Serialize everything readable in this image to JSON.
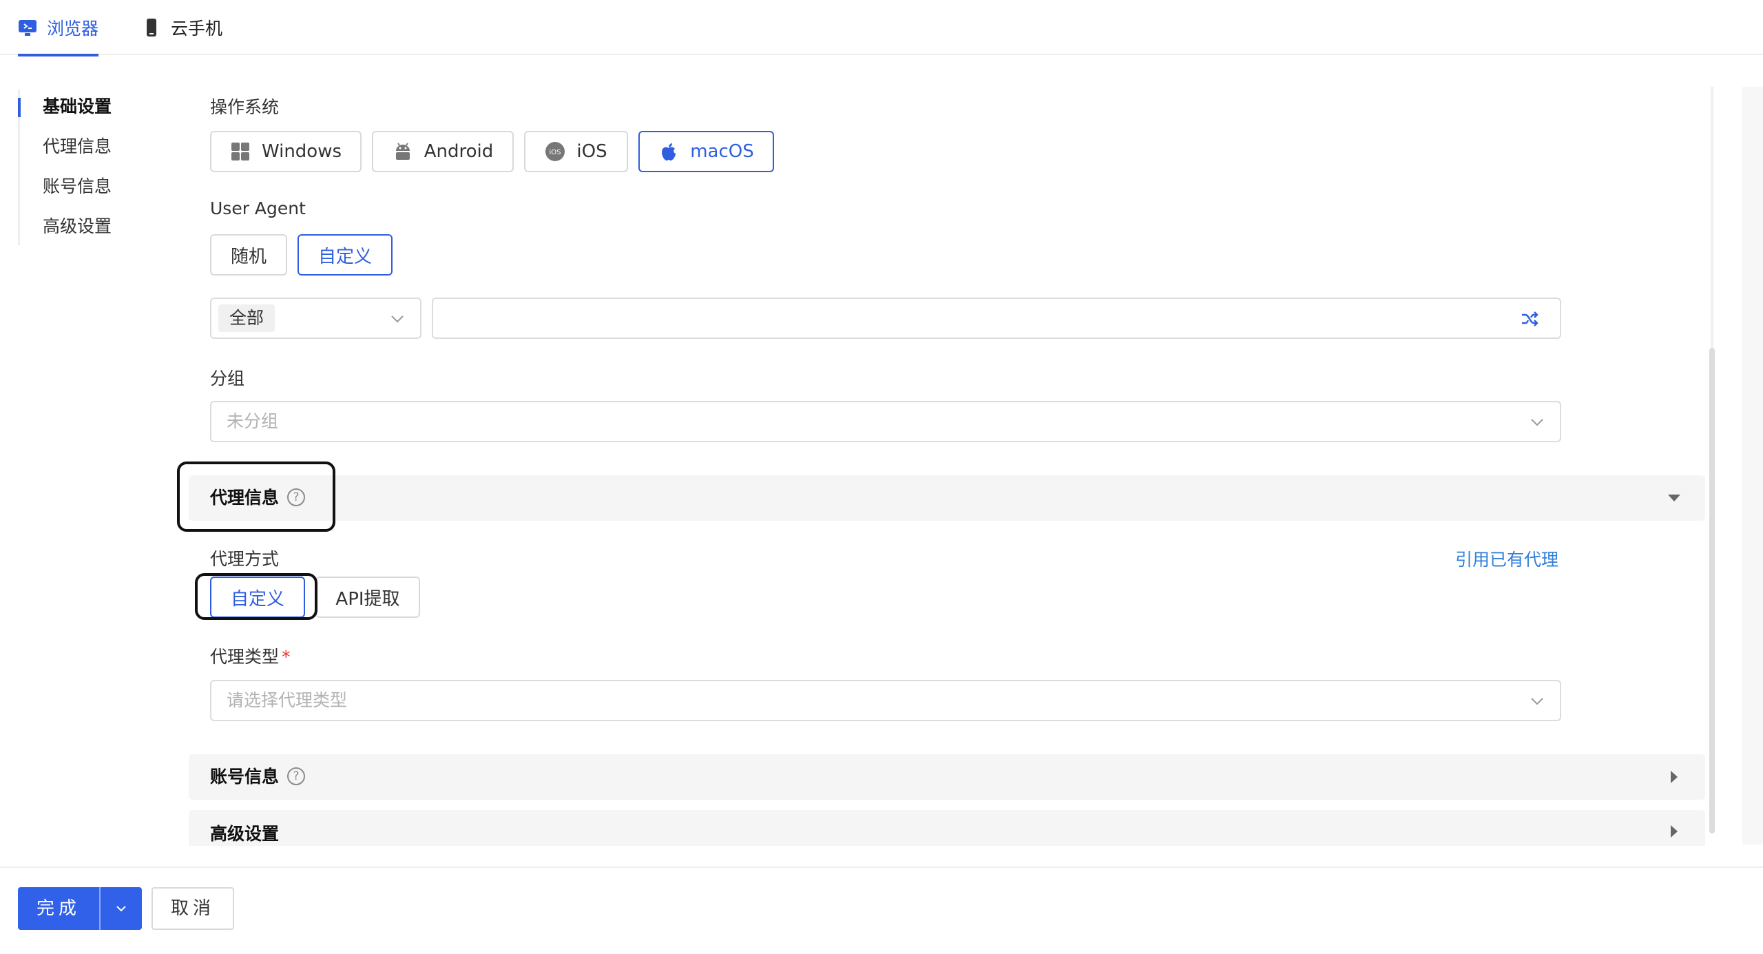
{
  "top_tabs": [
    {
      "label": "浏览器",
      "icon": "browser-icon",
      "active": true
    },
    {
      "label": "云手机",
      "icon": "phone-icon",
      "active": false
    }
  ],
  "nav": [
    {
      "label": "基础设置",
      "active": true
    },
    {
      "label": "代理信息",
      "active": false
    },
    {
      "label": "账号信息",
      "active": false
    },
    {
      "label": "高级设置",
      "active": false
    }
  ],
  "os": {
    "label": "操作系统",
    "options": [
      {
        "label": "Windows",
        "icon": "windows-icon"
      },
      {
        "label": "Android",
        "icon": "android-icon"
      },
      {
        "label": "iOS",
        "icon": "ios-icon"
      },
      {
        "label": "macOS",
        "icon": "apple-icon"
      }
    ],
    "selected": "macOS"
  },
  "user_agent": {
    "label": "User Agent",
    "options": [
      "随机",
      "自定义"
    ],
    "selected": "自定义",
    "filter_tag": "全部",
    "value": ""
  },
  "group": {
    "label": "分组",
    "placeholder": "未分组"
  },
  "proxy_section": {
    "title": "代理信息",
    "mode_label": "代理方式",
    "mode_options": [
      "自定义",
      "API提取"
    ],
    "mode_selected": "自定义",
    "use_existing_link": "引用已有代理",
    "type_label": "代理类型",
    "type_required": "*",
    "type_placeholder": "请选择代理类型"
  },
  "account_section": {
    "title": "账号信息"
  },
  "advanced_section": {
    "title": "高级设置"
  },
  "footer": {
    "confirm": "完成",
    "cancel": "取消"
  },
  "colors": {
    "accent": "#3061e8",
    "link": "#2f7fd9",
    "required": "#e53935"
  }
}
